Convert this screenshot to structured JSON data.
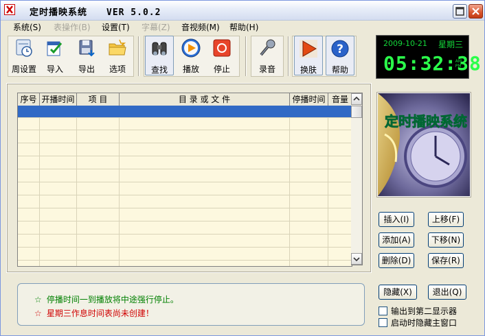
{
  "window": {
    "title": "定时播映系统　　VER 5.0.2"
  },
  "menu": [
    {
      "label": "系统(S)",
      "enabled": true
    },
    {
      "label": "表操作(B)",
      "enabled": false
    },
    {
      "label": "设置(T)",
      "enabled": true
    },
    {
      "label": "字幕(Z)",
      "enabled": false
    },
    {
      "label": "音视频(M)",
      "enabled": true
    },
    {
      "label": "帮助(H)",
      "enabled": true
    }
  ],
  "toolbar": {
    "week_setting": "周设置",
    "import": "导入",
    "export": "导出",
    "options": "选项",
    "find": "查找",
    "play": "播放",
    "stop": "停止",
    "record": "录音",
    "skin": "换肤",
    "help": "帮助"
  },
  "clock": {
    "date": "2009-10-21",
    "weekday": "星期三",
    "time": "05:32:38",
    "am": "AM",
    "pm": "PM"
  },
  "table": {
    "columns": [
      "序号",
      "开播时间",
      "项 目",
      "目 录 或 文 件",
      "停播时间",
      "音量"
    ],
    "rows": []
  },
  "art": {
    "title": "定时播映系统"
  },
  "side_buttons": {
    "insert": "插入(I)",
    "move_up": "上移(F)",
    "add": "添加(A)",
    "move_down": "下移(N)",
    "delete": "删除(D)",
    "save": "保存(R)",
    "hide": "隐藏(X)",
    "exit": "退出(Q)"
  },
  "messages": [
    {
      "star": "☆",
      "text": "停播时间一到播放将中途强行停止。",
      "color": "#008000"
    },
    {
      "star": "☆",
      "text": "星期三作息时间表尚未创建！",
      "color": "#d00000"
    }
  ],
  "checkboxes": {
    "second_display": "输出到第二显示器",
    "hide_on_start": "启动时隐藏主窗口"
  }
}
